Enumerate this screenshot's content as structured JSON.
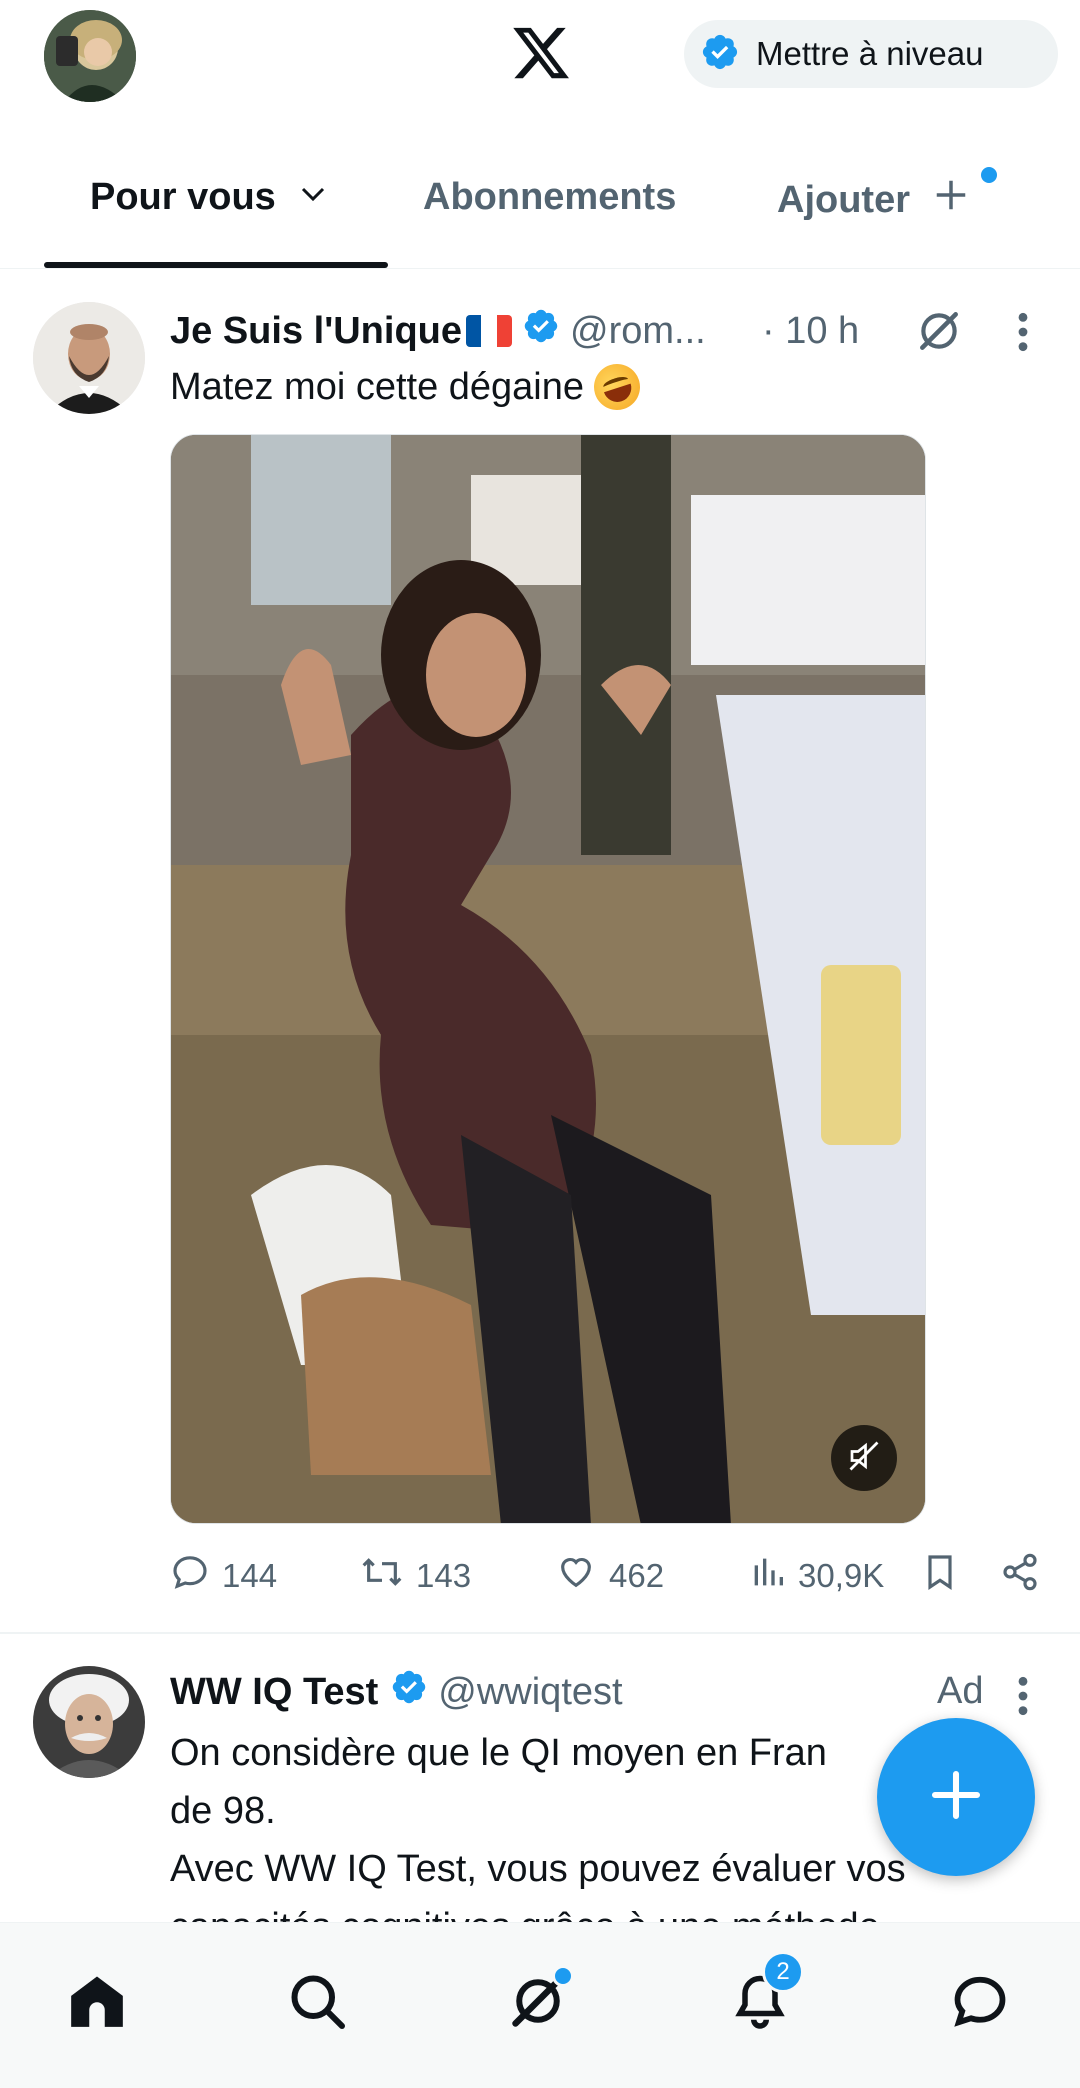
{
  "header": {
    "upgrade_label": "Mettre à niveau",
    "tabs": [
      {
        "label": "Pour vous",
        "active": true
      },
      {
        "label": "Abonnements",
        "active": false
      },
      {
        "label": "Ajouter",
        "active": false
      }
    ]
  },
  "tweet": {
    "name": "Je Suis l'Unique",
    "handle": "@rom...",
    "time": "· 10 h",
    "text": "Matez moi cette dégaine",
    "emoji": "rolling-on-floor-laughing",
    "stats": {
      "replies": "144",
      "reposts": "143",
      "likes": "462",
      "views": "30,9K"
    }
  },
  "ad": {
    "name": "WW IQ Test",
    "handle": "@wwiqtest",
    "label": "Ad",
    "lines": [
      "On considère que le QI moyen en Fran",
      "de 98.",
      "Avec WW IQ Test, vous pouvez évaluer vos",
      "capacités cognitives grâce à une méthode"
    ]
  },
  "nav": {
    "items": [
      "home-icon",
      "search-icon",
      "grok-icon",
      "notifications-icon",
      "messages-icon"
    ],
    "notifications_count": "2"
  },
  "colors": {
    "accent": "#1d9bf0",
    "text": "#0f1419",
    "muted": "#536471"
  }
}
